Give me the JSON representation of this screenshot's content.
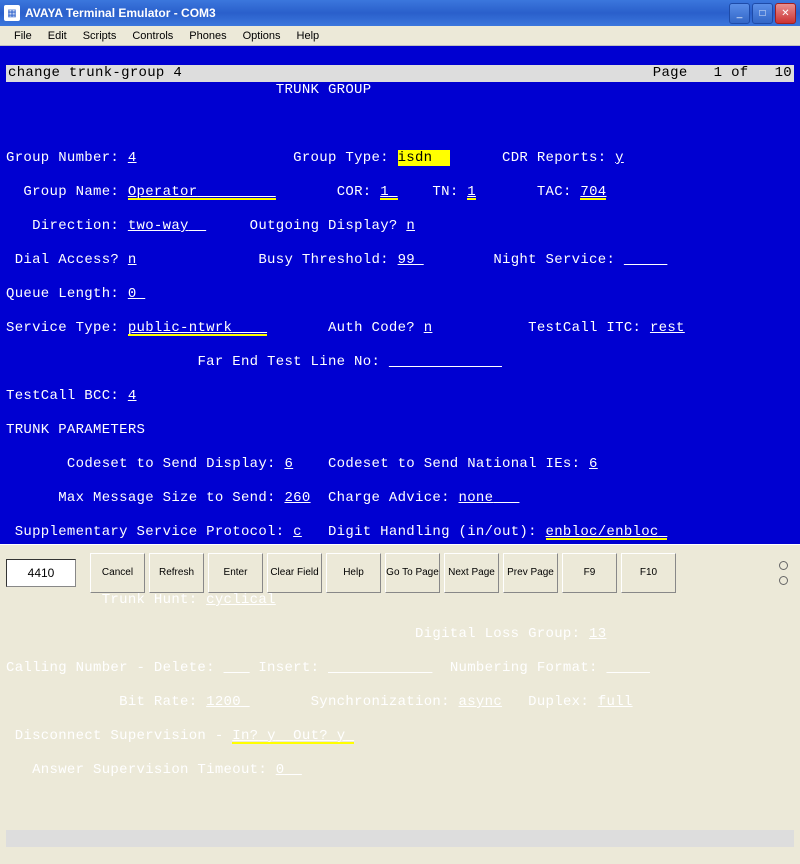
{
  "window": {
    "title": "AVAYA Terminal Emulator - COM3"
  },
  "menu": [
    "File",
    "Edit",
    "Scripts",
    "Controls",
    "Phones",
    "Options",
    "Help"
  ],
  "cmdline": {
    "left": "change trunk-group 4",
    "right": "Page   1 of   10"
  },
  "header": "TRUNK GROUP",
  "fields": {
    "group_number_lbl": "Group Number:",
    "group_number": "4",
    "group_type_lbl": "Group Type:",
    "group_type": "isdn",
    "cdr_lbl": "CDR Reports:",
    "cdr": "y",
    "group_name_lbl": "Group Name:",
    "group_name": "Operator",
    "cor_lbl": "COR:",
    "cor": "1",
    "tn_lbl": "TN:",
    "tn": "1",
    "tac_lbl": "TAC:",
    "tac": "704",
    "direction_lbl": "Direction:",
    "direction": "two-way",
    "outgoing_disp_lbl": "Outgoing Display?",
    "outgoing_disp": "n",
    "dial_access_lbl": "Dial Access?",
    "dial_access": "n",
    "busy_thresh_lbl": "Busy Threshold:",
    "busy_thresh": "99",
    "night_service_lbl": "Night Service:",
    "night_service": "",
    "queue_len_lbl": "Queue Length:",
    "queue_len": "0",
    "service_type_lbl": "Service Type:",
    "service_type": "public-ntwrk",
    "auth_code_lbl": "Auth Code?",
    "auth_code": "n",
    "testcall_itc_lbl": "TestCall ITC:",
    "testcall_itc": "rest",
    "far_end_lbl": "Far End Test Line No:",
    "far_end": "",
    "testcall_bcc_lbl": "TestCall BCC:",
    "testcall_bcc": "4",
    "trunk_params_hdr": "TRUNK PARAMETERS",
    "codeset_disp_lbl": "Codeset to Send Display:",
    "codeset_disp": "6",
    "codeset_nat_lbl": "Codeset to Send National IEs:",
    "codeset_nat": "6",
    "max_msg_lbl": "Max Message Size to Send:",
    "max_msg": "260",
    "charge_adv_lbl": "Charge Advice:",
    "charge_adv": "none",
    "supp_svc_lbl": "Supplementary Service Protocol:",
    "supp_svc": "c",
    "digit_hand_lbl": "Digit Handling (in/out):",
    "digit_hand": "enbloc/enbloc",
    "trunk_hunt_lbl": "Trunk Hunt:",
    "trunk_hunt": "cyclical",
    "dig_loss_lbl": "Digital Loss Group:",
    "dig_loss": "13",
    "call_del_lbl": "Calling Number - Delete:",
    "call_del": "",
    "insert_lbl": "Insert:",
    "insert": "",
    "num_fmt_lbl": "Numbering Format:",
    "num_fmt": "",
    "bit_rate_lbl": "Bit Rate:",
    "bit_rate": "1200",
    "sync_lbl": "Synchronization:",
    "sync": "async",
    "duplex_lbl": "Duplex:",
    "duplex": "full",
    "disc_sup_lbl": "Disconnect Supervision -",
    "disc_in_lbl": "In?",
    "disc_in": "y",
    "disc_out_lbl": "Out?",
    "disc_out": "y",
    "ans_sup_lbl": "Answer Supervision Timeout:",
    "ans_sup": "0"
  },
  "bottombar": {
    "term_type": "4410",
    "buttons": [
      "Cancel",
      "Refresh",
      "Enter",
      "Clear Field",
      "Help",
      "Go To Page",
      "Next Page",
      "Prev Page",
      "F9",
      "F10"
    ]
  }
}
